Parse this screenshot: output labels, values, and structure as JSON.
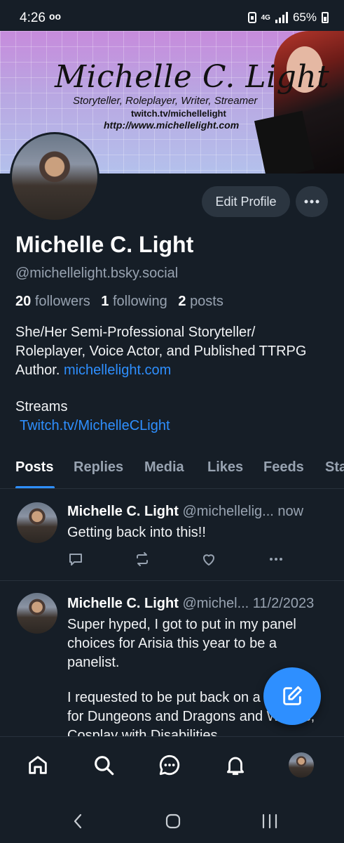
{
  "status_bar": {
    "time": "4:26",
    "voicemail_icon": "oo",
    "network": "4G",
    "battery": "65%"
  },
  "banner": {
    "title": "Michelle C. Light",
    "subtitle": "Storyteller, Roleplayer, Writer, Streamer",
    "url_twitch": "twitch.tv/michellelight",
    "url_site": "http://www.michellelight.com"
  },
  "profile": {
    "edit_label": "Edit Profile",
    "more_label": "•••",
    "display_name": "Michelle C. Light",
    "handle": "@michellelight.bsky.social",
    "followers_count": "20",
    "followers_label": "followers",
    "following_count": "1",
    "following_label": "following",
    "posts_count": "2",
    "posts_label": "posts",
    "bio": "She/Her Semi-Professional Storyteller/ Roleplayer, Voice Actor, and Published TTRPG Author.",
    "bio_link": "michellelight.com",
    "streams_label": "Streams",
    "streams_link": "Twitch.tv/MichelleCLight"
  },
  "tabs": [
    "Posts",
    "Replies",
    "Media",
    "Likes",
    "Feeds",
    "Sta"
  ],
  "posts": [
    {
      "author": "Michelle C. Light",
      "handle": "@michellelig...",
      "time": "now",
      "text": "Getting back into this!!"
    },
    {
      "author": "Michelle C. Light",
      "handle": "@michel...",
      "time": "11/2/2023",
      "text_1": "Super hyped, I got to put in my panel choices for Arisia this year to be a panelist.",
      "text_2": "I requested to be put back on a panelist for Dungeons and Dragons and Writers, Cosplay with Disabilities"
    }
  ],
  "icons": {
    "reply": "reply-icon",
    "repost": "repost-icon",
    "like": "heart-icon",
    "more": "more-icon",
    "compose": "compose-icon",
    "home": "home-icon",
    "search": "search-icon",
    "chat": "chat-icon",
    "notifications": "bell-icon"
  },
  "colors": {
    "background": "#161e27",
    "accent": "#2e8fff",
    "muted": "#98a3b1"
  }
}
